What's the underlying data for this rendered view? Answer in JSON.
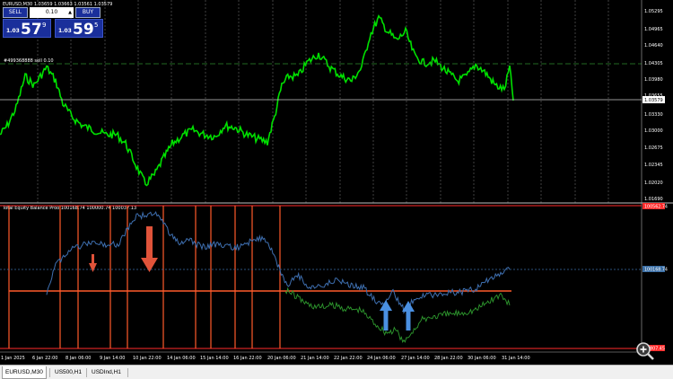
{
  "main_chart": {
    "title": "EURUSD,M30  1.03659 1.03663 1.03561 1.03579",
    "order_label": "#499368888 sell 0.10",
    "price_axis": [
      "1.05295",
      "1.04965",
      "1.04640",
      "1.04305",
      "1.03980",
      "1.03655",
      "1.03579",
      "1.03330",
      "1.03000",
      "1.02675",
      "1.02345",
      "1.02020",
      "1.01690"
    ],
    "current_price": "1.03579"
  },
  "trade_panel": {
    "sell_label": "SELL",
    "buy_label": "BUY",
    "lot_value": "0.10",
    "sell_prefix": "1.03",
    "sell_big": "57",
    "sell_sup": "9",
    "buy_prefix": "1.03",
    "buy_big": "59",
    "buy_sup": "5"
  },
  "indicator": {
    "title": "Total Equity Balance Proo  100168.74  100000.74  100037.13",
    "axis_top": "100562.74",
    "axis_mid": "100168.74",
    "axis_bottom": "99807.45"
  },
  "time_axis": [
    "1 Jan 2025",
    "6 Jan 22:00",
    "8 Jan 06:00",
    "9 Jan 14:00",
    "10 Jan 22:00",
    "14 Jan 06:00",
    "15 Jan 14:00",
    "16 Jan 22:00",
    "20 Jan 06:00",
    "21 Jan 14:00",
    "22 Jan 22:00",
    "24 Jan 06:00",
    "27 Jan 14:00",
    "28 Jan 22:00",
    "30 Jan 06:00",
    "31 Jan 14:00"
  ],
  "tabs": [
    "EURUSD,M30",
    "US500,H1",
    "USDInd,H1"
  ],
  "icons": {
    "zoom": "zoom-in-icon",
    "spin": "spinner-arrows-icon"
  }
}
